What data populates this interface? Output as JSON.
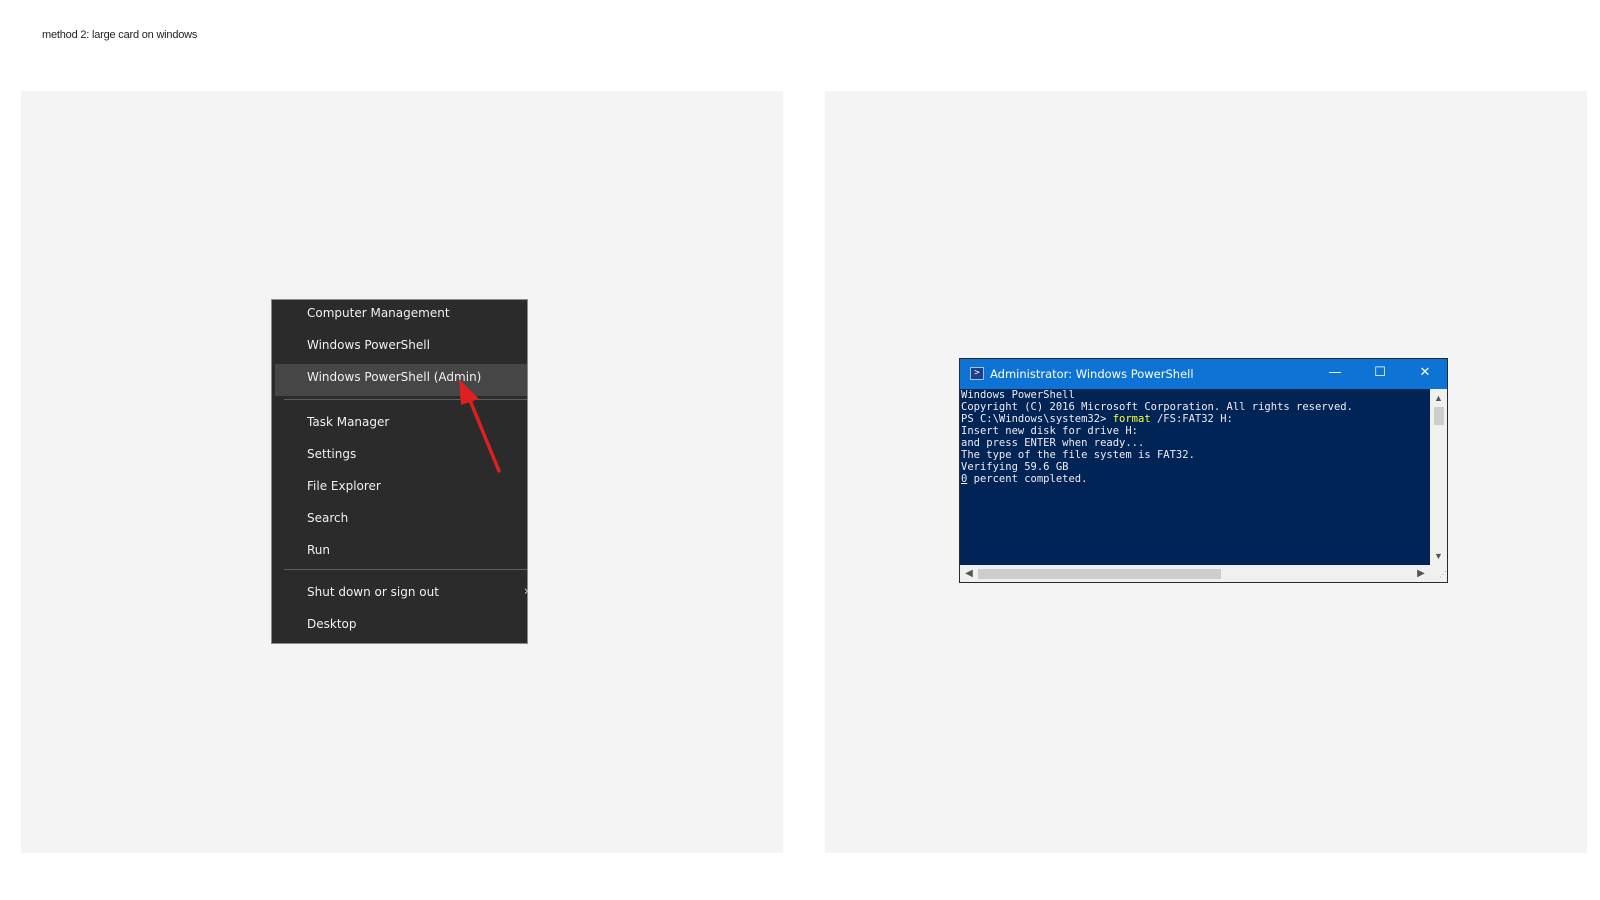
{
  "page": {
    "title": "method 2: large card on windows"
  },
  "winx_menu": {
    "items": [
      {
        "label": "Computer Management"
      },
      {
        "label": "Windows PowerShell"
      },
      {
        "label": "Windows PowerShell (Admin)",
        "highlighted": true
      },
      {
        "label": "Task Manager"
      },
      {
        "label": "Settings"
      },
      {
        "label": "File Explorer"
      },
      {
        "label": "Search"
      },
      {
        "label": "Run"
      },
      {
        "label": "Shut down or sign out",
        "has_submenu": true
      },
      {
        "label": "Desktop"
      }
    ],
    "submenu_arrow": "›",
    "annotation_color": "#e02020"
  },
  "powershell": {
    "title": "Administrator: Windows PowerShell",
    "controls": {
      "minimize": "—",
      "maximize": "☐",
      "close": "✕"
    },
    "lines": {
      "l1": "Windows PowerShell",
      "l2": "Copyright (C) 2016 Microsoft Corporation. All rights reserved.",
      "l3": "",
      "prompt": "PS C:\\Windows\\system32> ",
      "command": "format",
      "args": " /FS:FAT32 H:",
      "l5": "Insert new disk for drive H:",
      "l6": "and press ENTER when ready...",
      "l7": "The type of the file system is FAT32.",
      "l8": "Verifying 59.6 GB",
      "percent": "0",
      "percent_rest": " percent completed."
    },
    "colors": {
      "console_bg": "#012456",
      "console_fg": "#eeedf0",
      "command": "#ffff3c",
      "titlebar": "#0d74d6"
    }
  }
}
